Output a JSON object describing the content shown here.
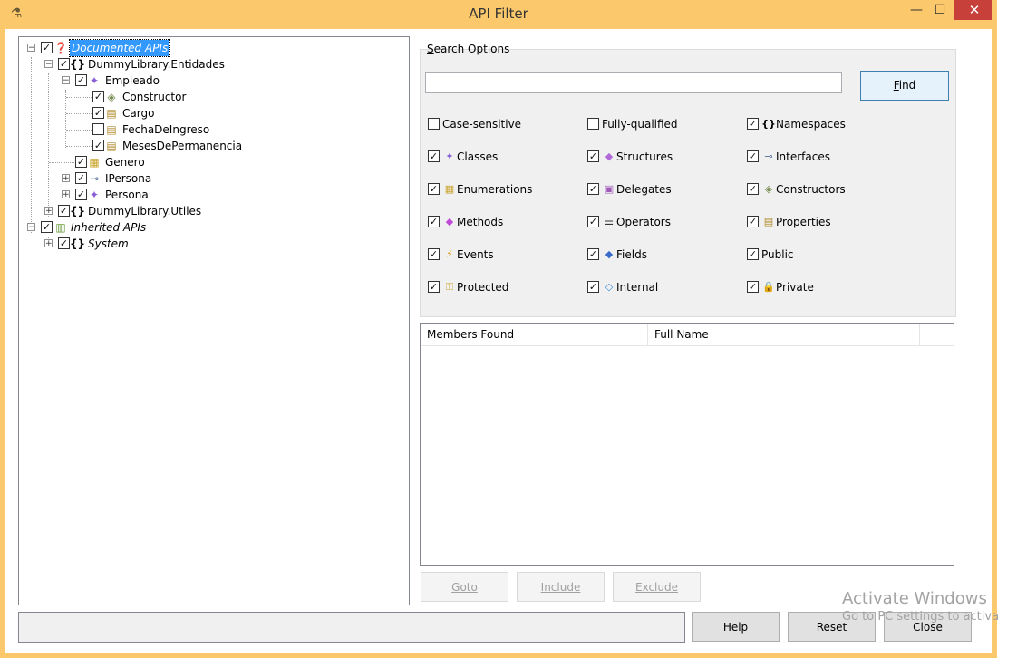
{
  "window": {
    "title": "API Filter",
    "minimize_glyph": "—",
    "maximize_glyph": "☐",
    "close_glyph": "✕"
  },
  "tree": {
    "nodes": [
      {
        "label": "Documented APIs",
        "checked": true,
        "icon": "help-icon"
      },
      {
        "label": "DummyLibrary.Entidades",
        "checked": true,
        "icon": "namespace-icon"
      },
      {
        "label": "Empleado",
        "checked": true,
        "icon": "class-icon"
      },
      {
        "label": "Constructor",
        "checked": true,
        "icon": "constructor-icon"
      },
      {
        "label": "Cargo",
        "checked": true,
        "icon": "property-icon"
      },
      {
        "label": "FechaDeIngreso",
        "checked": false,
        "icon": "property-icon"
      },
      {
        "label": "MesesDePermanencia",
        "checked": true,
        "icon": "property-icon"
      },
      {
        "label": "Genero",
        "checked": true,
        "icon": "enumeration-icon"
      },
      {
        "label": "IPersona",
        "checked": true,
        "icon": "interface-icon"
      },
      {
        "label": "Persona",
        "checked": true,
        "icon": "class-icon"
      },
      {
        "label": "DummyLibrary.Utiles",
        "checked": true,
        "icon": "namespace-icon"
      },
      {
        "label": "Inherited APIs",
        "checked": true,
        "icon": "inherited-icon"
      },
      {
        "label": "System",
        "checked": true,
        "icon": "namespace-icon"
      }
    ]
  },
  "search": {
    "group_label": "Search Options",
    "input_value": "",
    "find_label": "Find"
  },
  "options": [
    {
      "label": "Case-sensitive",
      "checked": false,
      "icon": ""
    },
    {
      "label": "Fully-qualified",
      "checked": false,
      "icon": ""
    },
    {
      "label": "Namespaces",
      "checked": true,
      "icon": "namespace-icon"
    },
    {
      "label": "Classes",
      "checked": true,
      "icon": "class-icon"
    },
    {
      "label": "Structures",
      "checked": true,
      "icon": "structure-icon"
    },
    {
      "label": "Interfaces",
      "checked": true,
      "icon": "interface-icon"
    },
    {
      "label": "Enumerations",
      "checked": true,
      "icon": "enumeration-icon"
    },
    {
      "label": "Delegates",
      "checked": true,
      "icon": "delegate-icon"
    },
    {
      "label": "Constructors",
      "checked": true,
      "icon": "constructor-icon"
    },
    {
      "label": "Methods",
      "checked": true,
      "icon": "method-icon"
    },
    {
      "label": "Operators",
      "checked": true,
      "icon": "operator-icon"
    },
    {
      "label": "Properties",
      "checked": true,
      "icon": "property-icon"
    },
    {
      "label": "Events",
      "checked": true,
      "icon": "event-icon"
    },
    {
      "label": "Fields",
      "checked": true,
      "icon": "field-icon"
    },
    {
      "label": "Public",
      "checked": true,
      "icon": ""
    },
    {
      "label": "Protected",
      "checked": true,
      "icon": "protected-icon"
    },
    {
      "label": "Internal",
      "checked": true,
      "icon": "internal-icon"
    },
    {
      "label": "Private",
      "checked": true,
      "icon": "private-icon"
    }
  ],
  "results": {
    "columns": [
      "Members Found",
      "Full Name"
    ]
  },
  "actions": {
    "goto": "Goto",
    "include": "Include",
    "exclude": "Exclude",
    "help": "Help",
    "reset": "Reset",
    "close": "Close"
  },
  "status_text": "",
  "watermark": {
    "line1": "Activate Windows",
    "line2": "Go to PC settings to activa"
  },
  "colors": {
    "title_bar": "#fbc86c",
    "close_button": "#c7413a",
    "selection": "#3399ff",
    "default_button_border": "#3c7fb1"
  }
}
